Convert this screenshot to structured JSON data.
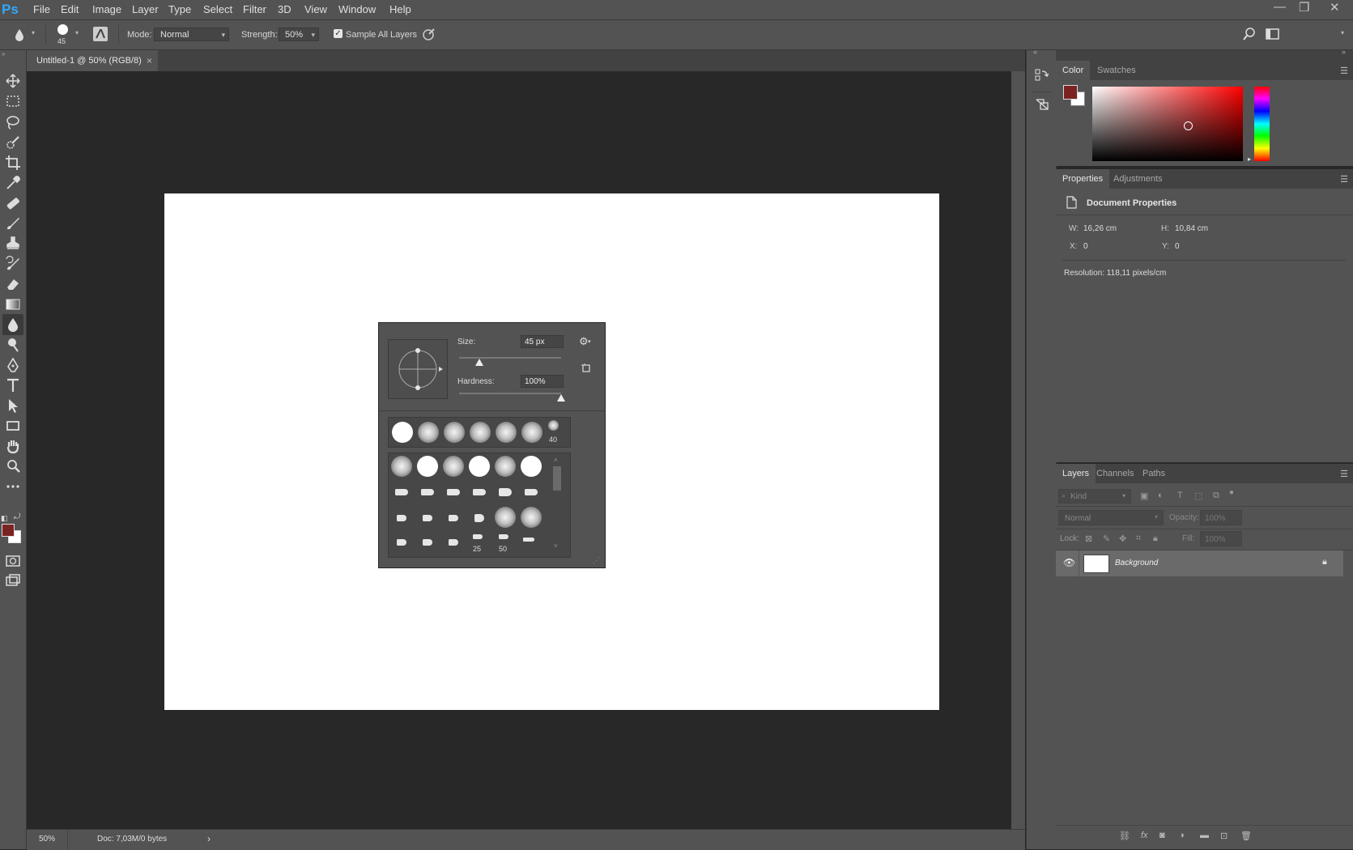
{
  "app": {
    "logo": "Ps"
  },
  "menu": [
    "File",
    "Edit",
    "Image",
    "Layer",
    "Type",
    "Select",
    "Filter",
    "3D",
    "View",
    "Window",
    "Help"
  ],
  "window_controls": {
    "minimize": "—",
    "restore": "❐",
    "close": "✕"
  },
  "options": {
    "brush_size_value": "45",
    "mode_label": "Mode:",
    "mode_value": "Normal",
    "strength_label": "Strength:",
    "strength_value": "50%",
    "sample_all_layers_label": "Sample All Layers",
    "sample_all_layers_checked": true
  },
  "document": {
    "tab_title": "Untitled-1 @ 50% (RGB/8)",
    "tab_close": "×"
  },
  "status": {
    "zoom": "50%",
    "doc_info": "Doc: 7,03M/0 bytes",
    "arrow": "›"
  },
  "brush_popup": {
    "size_label": "Size:",
    "size_value": "45 px",
    "size_pct": 0.2,
    "hardness_label": "Hardness:",
    "hardness_value": "100%",
    "hardness_pct": 1.0,
    "recent_count_label": "40",
    "preset_labels": [
      "25",
      "50"
    ]
  },
  "color_panel": {
    "tabs": [
      "Color",
      "Swatches"
    ],
    "foreground": "#7b2323",
    "background": "#ffffff"
  },
  "properties_panel": {
    "tabs": [
      "Properties",
      "Adjustments"
    ],
    "section_title": "Document Properties",
    "w_label": "W:",
    "w_value": "16,26 cm",
    "h_label": "H:",
    "h_value": "10,84 cm",
    "x_label": "X:",
    "x_value": "0",
    "y_label": "Y:",
    "y_value": "0",
    "resolution": "Resolution: 118,11 pixels/cm"
  },
  "layers_panel": {
    "tabs": [
      "Layers",
      "Channels",
      "Paths"
    ],
    "filter_placeholder": "Kind",
    "blend_mode": "Normal",
    "opacity_label": "Opacity:",
    "opacity_value": "100%",
    "lock_label": "Lock:",
    "fill_label": "Fill:",
    "fill_value": "100%",
    "layers": [
      {
        "name": "Background",
        "visible": true,
        "locked": true
      }
    ]
  },
  "colors": {
    "accent_blue": "#31a8ff",
    "ui_panel": "#535353",
    "canvas_bg": "#282828"
  }
}
